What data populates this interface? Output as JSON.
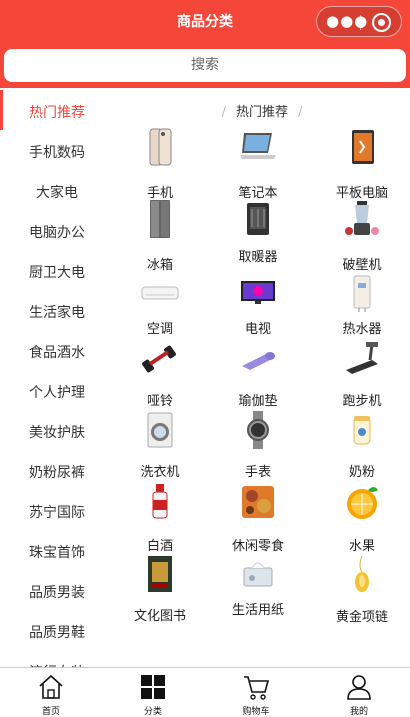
{
  "header": {
    "title": "商品分类"
  },
  "capsule": {
    "more_icon": "more-dots-icon",
    "close_icon": "target-circle-icon"
  },
  "search": {
    "placeholder": "搜索"
  },
  "sidebar": {
    "items": [
      {
        "label": "热门推荐",
        "active": true
      },
      {
        "label": "手机数码"
      },
      {
        "label": "大家电"
      },
      {
        "label": "电脑办公"
      },
      {
        "label": "厨卫大电"
      },
      {
        "label": "生活家电"
      },
      {
        "label": "食品酒水"
      },
      {
        "label": "个人护理"
      },
      {
        "label": "美妆护肤"
      },
      {
        "label": "奶粉尿裤"
      },
      {
        "label": "苏宁国际"
      },
      {
        "label": "珠宝首饰"
      },
      {
        "label": "品质男装"
      },
      {
        "label": "品质男鞋"
      },
      {
        "label": "流行女装"
      }
    ]
  },
  "section": {
    "title": "热门推荐"
  },
  "products": [
    {
      "name": "手机",
      "icon": "phone-icon"
    },
    {
      "name": "笔记本",
      "icon": "laptop-icon"
    },
    {
      "name": "平板电脑",
      "icon": "tablet-icon"
    },
    {
      "name": "冰箱",
      "icon": "fridge-icon"
    },
    {
      "name": "取暖器",
      "icon": "heater-icon"
    },
    {
      "name": "破壁机",
      "icon": "blender-icon"
    },
    {
      "name": "空调",
      "icon": "aircon-icon"
    },
    {
      "name": "电视",
      "icon": "tv-icon"
    },
    {
      "name": "热水器",
      "icon": "water-heater-icon"
    },
    {
      "name": "哑铃",
      "icon": "dumbbell-icon"
    },
    {
      "name": "瑜伽垫",
      "icon": "yoga-mat-icon"
    },
    {
      "name": "跑步机",
      "icon": "treadmill-icon"
    },
    {
      "name": "洗衣机",
      "icon": "washer-icon"
    },
    {
      "name": "手表",
      "icon": "watch-icon"
    },
    {
      "name": "奶粉",
      "icon": "milk-powder-icon"
    },
    {
      "name": "白酒",
      "icon": "liquor-icon"
    },
    {
      "name": "休闲零食",
      "icon": "snacks-icon"
    },
    {
      "name": "水果",
      "icon": "fruit-icon"
    },
    {
      "name": "文化图书",
      "icon": "book-icon"
    },
    {
      "name": "生活用纸",
      "icon": "tissue-icon"
    },
    {
      "name": "黄金项链",
      "icon": "gold-necklace-icon"
    }
  ],
  "tabbar": {
    "tabs": [
      {
        "label": "首页",
        "icon": "home-icon"
      },
      {
        "label": "分类",
        "icon": "category-grid-icon"
      },
      {
        "label": "购物车",
        "icon": "cart-icon"
      },
      {
        "label": "我的",
        "icon": "user-icon"
      }
    ]
  },
  "colors": {
    "brand": "#f4473a",
    "active_text": "#f4473a"
  }
}
